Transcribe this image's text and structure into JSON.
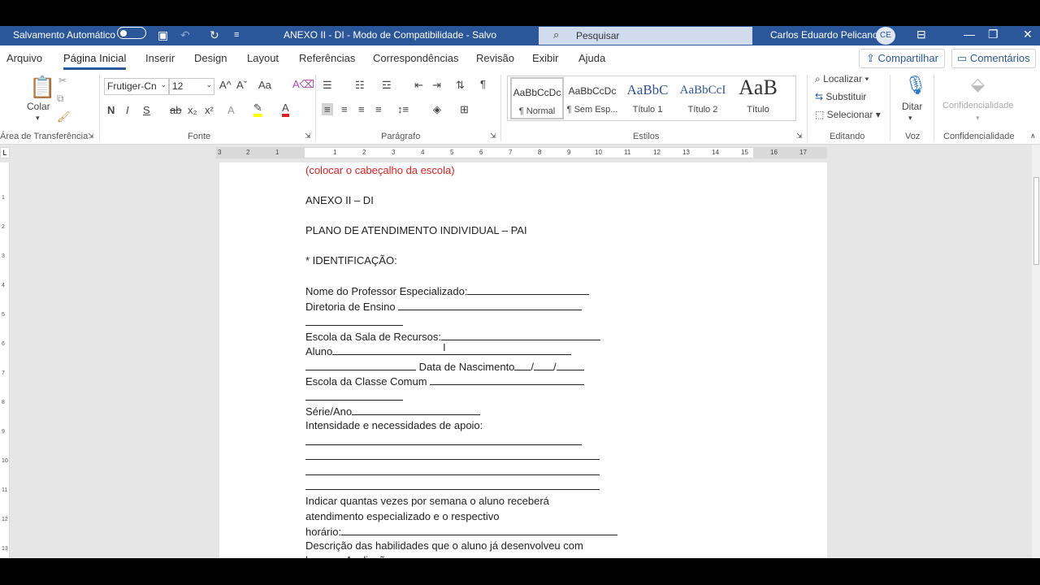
{
  "titlebar": {
    "autosave_label": "Salvamento Automático",
    "document_title": "ANEXO II - DI  -  Modo de Compatibilidade  -  Salvo",
    "search_placeholder": "Pesquisar",
    "user_name": "Carlos Eduardo Pelicano",
    "user_initials": "CE"
  },
  "tabs": [
    "Arquivo",
    "Página Inicial",
    "Inserir",
    "Design",
    "Layout",
    "Referências",
    "Correspondências",
    "Revisão",
    "Exibir",
    "Ajuda"
  ],
  "active_tab": "Página Inicial",
  "actions": {
    "share": "Compartilhar",
    "comments": "Comentários"
  },
  "ribbon": {
    "clipboard": {
      "paste_label": "Colar",
      "group_label": "Área de Transferência"
    },
    "font": {
      "family": "Frutiger-Cn",
      "size": "12",
      "group_label": "Fonte",
      "bold": "N",
      "italic": "I",
      "underline": "S",
      "strike": "ab",
      "sub": "x₂",
      "sup": "x²",
      "grow": "A^",
      "shrink": "Aˇ",
      "case": "Aa",
      "color_letter": "A"
    },
    "paragraph": {
      "group_label": "Parágrafo"
    },
    "styles": {
      "group_label": "Estilos",
      "items": [
        {
          "preview": "AaBbCcDc",
          "name": "¶ Normal"
        },
        {
          "preview": "AaBbCcDc",
          "name": "¶ Sem Esp..."
        },
        {
          "preview": "AaBbC",
          "name": "Título 1"
        },
        {
          "preview": "AaBbCcI",
          "name": "Título 2"
        },
        {
          "preview": "AaB",
          "name": "Título"
        }
      ]
    },
    "editing": {
      "group_label": "Editando",
      "find": "Localizar",
      "replace": "Substituir",
      "select": "Selecionar"
    },
    "voice": {
      "group_label": "Voz",
      "dictate": "Ditar"
    },
    "sensitivity": {
      "group_label": "Confidencialidade",
      "button": "Confidencialidade"
    }
  },
  "ruler": {
    "ticks": [
      "3",
      "2",
      "1",
      "1",
      "2",
      "3",
      "4",
      "5",
      "6",
      "7",
      "8",
      "9",
      "10",
      "11",
      "12",
      "13",
      "14",
      "15",
      "16",
      "17"
    ]
  },
  "vruler": {
    "ticks": [
      "1",
      "2",
      "3",
      "4",
      "5",
      "6",
      "7",
      "8",
      "9",
      "10",
      "11",
      "12",
      "13"
    ]
  },
  "document": {
    "header_note": "(colocar o cabeçalho da escola)",
    "annex": "ANEXO II – DI",
    "plan_title": "PLANO DE ATENDIMENTO INDIVIDUAL – PAI",
    "identification": "* IDENTIFICAÇÃO:",
    "teacher": "Nome do Professor Especializado:",
    "board": "Diretoria de Ensino",
    "resource_school": "Escola da Sala de Recursos:",
    "student": "Aluno",
    "birth": "Data de Nascimento",
    "common_school": "Escola da Classe Comum",
    "grade": "Série/Ano",
    "support": "Intensidade e necessidades de apoio:",
    "weekly_1": "Indicar quantas vezes por semana o aluno receberá",
    "weekly_2": "atendimento especializado e o respectivo",
    "schedule": "horário:",
    "skills": "Descrição das habilidades que o aluno já desenvolveu com",
    "skills_cont": "base na Avaliação"
  }
}
